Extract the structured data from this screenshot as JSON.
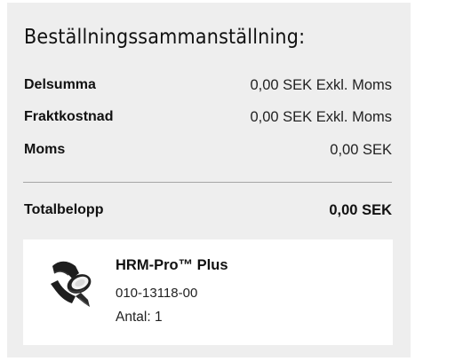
{
  "summary": {
    "title": "Beställningssammanställning:",
    "rows": [
      {
        "label": "Delsumma",
        "value": "0,00 SEK Exkl. Moms"
      },
      {
        "label": "Fraktkostnad",
        "value": "0,00 SEK Exkl. Moms"
      },
      {
        "label": "Moms",
        "value": "0,00 SEK"
      }
    ],
    "total": {
      "label": "Totalbelopp",
      "value": "0,00 SEK"
    }
  },
  "product": {
    "image_icon": "heart-rate-strap-icon",
    "name": "HRM-Pro™ Plus",
    "sku": "010-13118-00",
    "quantity": "Antal: 1"
  },
  "colors": {
    "panel_background": "#eeeeee",
    "card_background": "#ffffff",
    "divider": "#a6a6a6",
    "text": "#111111"
  }
}
